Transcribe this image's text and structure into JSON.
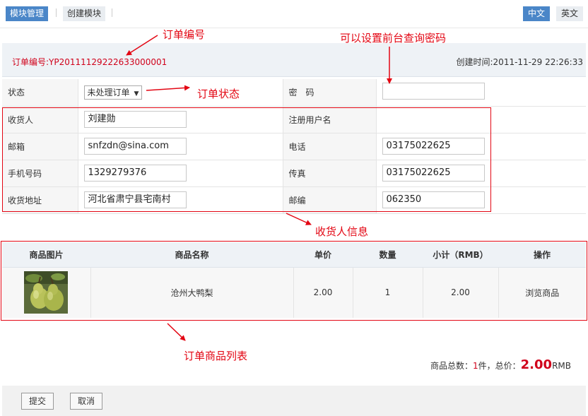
{
  "nav": {
    "tabs": [
      {
        "label": "模块管理",
        "active": true
      },
      {
        "label": "创建模块",
        "active": false
      }
    ],
    "languages": [
      {
        "label": "中文",
        "active": true
      },
      {
        "label": "英文",
        "active": false
      }
    ]
  },
  "order": {
    "number_label": "订单编号:YP20111129222633000001",
    "created_label": "创建时间:2011-11-29 22:26:33"
  },
  "form": {
    "status": {
      "label": "状态",
      "value": "未处理订单"
    },
    "password": {
      "label": "密　码",
      "value": ""
    },
    "consignee": {
      "label": "收货人",
      "value": "刘建勋"
    },
    "username": {
      "label": "注册用户名",
      "value": ""
    },
    "email": {
      "label": "邮箱",
      "value": "snfzdn@sina.com"
    },
    "phone": {
      "label": "电话",
      "value": "03175022625"
    },
    "mobile": {
      "label": "手机号码",
      "value": "1329279376"
    },
    "fax": {
      "label": "传真",
      "value": "03175022625"
    },
    "address": {
      "label": "收货地址",
      "value": "河北省肃宁县宅南村"
    },
    "zip": {
      "label": "邮编",
      "value": "062350"
    }
  },
  "products": {
    "headers": [
      "商品图片",
      "商品名称",
      "单价",
      "数量",
      "小计（RMB）",
      "操作"
    ],
    "rows": [
      {
        "image": "pear-photo",
        "name": "沧州大鸭梨",
        "price": "2.00",
        "qty": "1",
        "subtotal": "2.00",
        "action": "浏览商品"
      }
    ]
  },
  "totals": {
    "count_prefix": "商品总数：",
    "count": "1",
    "count_suffix": "件，总价：",
    "price": "2.00",
    "currency": "RMB"
  },
  "footer": {
    "submit_label": "提交",
    "cancel_label": "取消"
  },
  "annotations": {
    "order_no": "订单编号",
    "password": "可以设置前台查询密码",
    "status": "订单状态",
    "consignee_info": "收货人信息",
    "product_list": "订单商品列表"
  },
  "colors": {
    "accent": "#4a86c8",
    "annotation": "#e30613",
    "price": "#d0021b"
  }
}
